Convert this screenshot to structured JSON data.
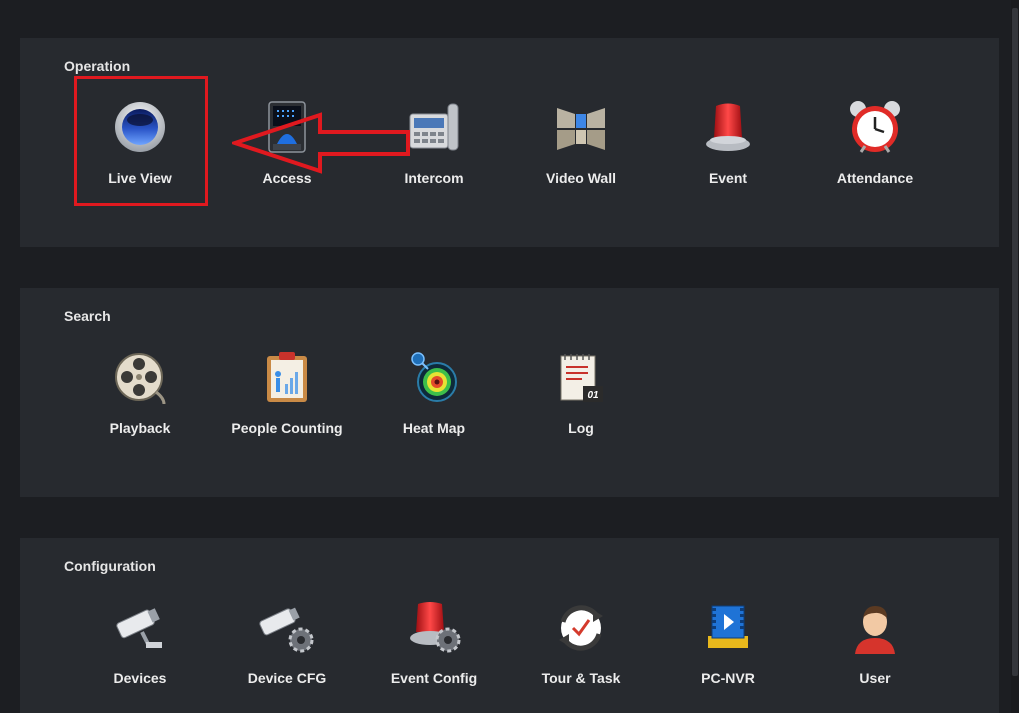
{
  "sections": [
    {
      "title": "Operation",
      "items": [
        {
          "label": "Live View",
          "icon": "live-view-icon"
        },
        {
          "label": "Access",
          "icon": "access-icon"
        },
        {
          "label": "Intercom",
          "icon": "intercom-icon"
        },
        {
          "label": "Video Wall",
          "icon": "video-wall-icon"
        },
        {
          "label": "Event",
          "icon": "event-icon"
        },
        {
          "label": "Attendance",
          "icon": "attendance-icon"
        }
      ]
    },
    {
      "title": "Search",
      "items": [
        {
          "label": "Playback",
          "icon": "playback-icon"
        },
        {
          "label": "People Counting",
          "icon": "people-counting-icon"
        },
        {
          "label": "Heat Map",
          "icon": "heat-map-icon"
        },
        {
          "label": "Log",
          "icon": "log-icon"
        }
      ]
    },
    {
      "title": "Configuration",
      "items": [
        {
          "label": "Devices",
          "icon": "devices-icon"
        },
        {
          "label": "Device CFG",
          "icon": "device-cfg-icon"
        },
        {
          "label": "Event Config",
          "icon": "event-config-icon"
        },
        {
          "label": "Tour & Task",
          "icon": "tour-task-icon"
        },
        {
          "label": "PC-NVR",
          "icon": "pc-nvr-icon"
        },
        {
          "label": "User",
          "icon": "user-icon"
        }
      ]
    }
  ],
  "log_icon_text": "01",
  "colors": {
    "annotation": "#e0191f",
    "panel": "#272a2f",
    "background": "#1c1e22"
  }
}
